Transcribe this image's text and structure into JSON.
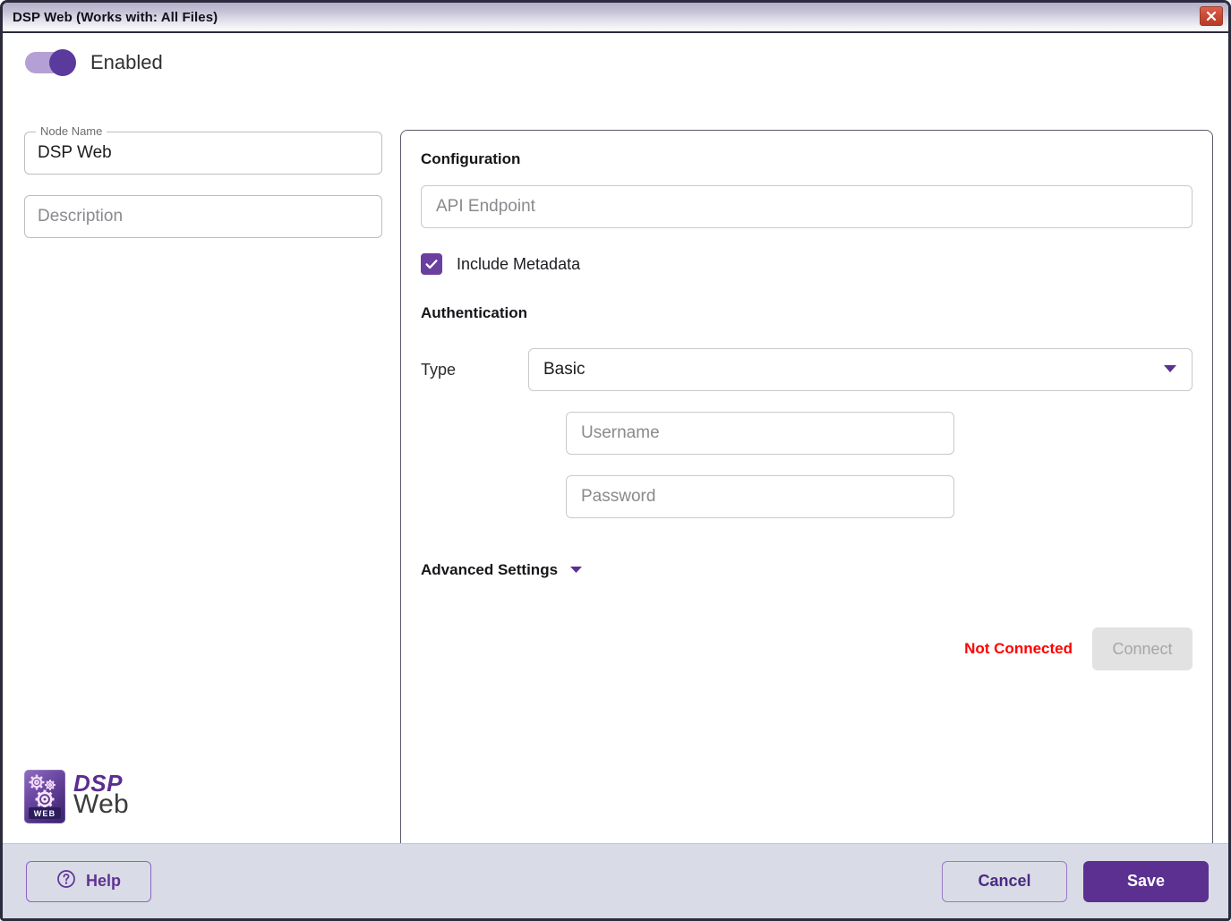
{
  "window": {
    "title": "DSP Web (Works with: All Files)",
    "close_label": "Close"
  },
  "enabled_toggle": {
    "label": "Enabled",
    "state": "on"
  },
  "left": {
    "node_name": {
      "legend": "Node Name",
      "value": "DSP Web"
    },
    "description": {
      "placeholder": "Description",
      "value": ""
    },
    "logo": {
      "badge_text": "WEB",
      "brand_primary": "DSP",
      "brand_secondary": "Web"
    }
  },
  "panel": {
    "configuration": {
      "title": "Configuration",
      "api_endpoint": {
        "placeholder": "API Endpoint",
        "value": ""
      },
      "include_metadata": {
        "label": "Include Metadata",
        "checked": true
      }
    },
    "authentication": {
      "title": "Authentication",
      "type": {
        "label": "Type",
        "selected": "Basic"
      },
      "username": {
        "placeholder": "Username",
        "value": ""
      },
      "password": {
        "placeholder": "Password",
        "value": ""
      }
    },
    "advanced_settings": {
      "label": "Advanced Settings"
    },
    "connection": {
      "status": "Not Connected",
      "connect_label": "Connect"
    }
  },
  "footer": {
    "help_label": "Help",
    "cancel_label": "Cancel",
    "save_label": "Save"
  },
  "colors": {
    "accent": "#5b3091",
    "accent_light": "#b4a0d4",
    "checkbox": "#6b3fa0",
    "status_error": "#fe0000",
    "footer_bg": "#d9dbe6",
    "close_btn": "#cb4b36"
  }
}
